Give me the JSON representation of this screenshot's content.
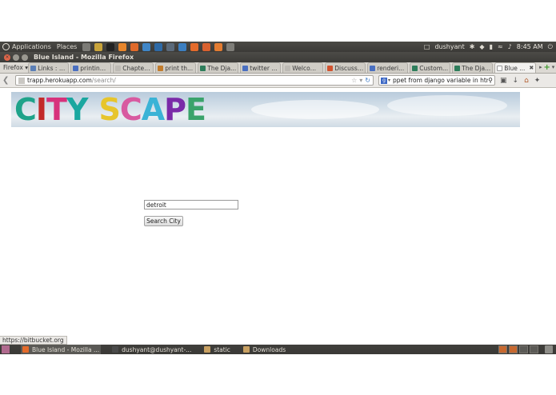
{
  "panel": {
    "menus": [
      "Applications",
      "Places"
    ],
    "launchers": [
      {
        "icon": "terminal-launcher-icon",
        "color": "#7c7b76"
      },
      {
        "icon": "notes-launcher-icon",
        "color": "#c9a43a"
      },
      {
        "icon": "camera-launcher-icon",
        "color": "#222222"
      },
      {
        "icon": "vlc-launcher-icon",
        "color": "#e8862b"
      },
      {
        "icon": "sublime-launcher-icon",
        "color": "#e06a2a"
      },
      {
        "icon": "qt-launcher-icon",
        "color": "#3f86c7"
      },
      {
        "icon": "eclipse-launcher-icon",
        "color": "#2e6aa6"
      },
      {
        "icon": "monitor-launcher-icon",
        "color": "#5b6a7a"
      },
      {
        "icon": "browser-launcher-icon",
        "color": "#3c7fc1"
      },
      {
        "icon": "firefox-launcher-icon",
        "color": "#e46b2b"
      },
      {
        "icon": "folder-launcher-icon",
        "color": "#d9612f"
      },
      {
        "icon": "archive-launcher-icon",
        "color": "#e37c31"
      },
      {
        "icon": "screen-launcher-icon",
        "color": "#7f7e79"
      }
    ],
    "user": "dushyant",
    "time": "8:45 AM"
  },
  "window": {
    "title": "Blue Island - Mozilla Firefox"
  },
  "tabstrip": {
    "firefox_menu": "Firefox",
    "tabs": [
      {
        "label": "Links : C...",
        "color": "#5b7fb6"
      },
      {
        "label": "printing...",
        "color": "#4a6fc0"
      },
      {
        "label": "Chapter...",
        "color": "#bdbab4"
      },
      {
        "label": "print th...",
        "color": "#c27c2c"
      },
      {
        "label": "The Dja...",
        "color": "#2e7d5b"
      },
      {
        "label": "twitter ...",
        "color": "#4a6fc0"
      },
      {
        "label": "Welcom...",
        "color": "#bdbab4"
      },
      {
        "label": "Discussi...",
        "color": "#d2532f"
      },
      {
        "label": "renderi...",
        "color": "#4a6fc0"
      },
      {
        "label": "Custom...",
        "color": "#2e7d5b"
      },
      {
        "label": "The Dja...",
        "color": "#2e7d5b"
      },
      {
        "label": "Blue ...",
        "color": "#ffffff",
        "active": true
      }
    ]
  },
  "navbar": {
    "url_host": "trapp.herokuapp.com",
    "url_path": "/search/",
    "search_query": "ppet from  django variable in html"
  },
  "page": {
    "logo": [
      {
        "ch": "C",
        "color": "#1fa38a"
      },
      {
        "ch": "I",
        "color": "#c22a2a"
      },
      {
        "ch": "T",
        "color": "#d7327c"
      },
      {
        "ch": "Y",
        "color": "#1aa7a0"
      },
      {
        "ch": " ",
        "color": "#ffffff"
      },
      {
        "ch": "S",
        "color": "#e7c52c"
      },
      {
        "ch": "C",
        "color": "#d85aa0"
      },
      {
        "ch": "A",
        "color": "#3bb3d6"
      },
      {
        "ch": "P",
        "color": "#7a2aa8"
      },
      {
        "ch": "E",
        "color": "#3aa36b"
      }
    ],
    "search_value": "detroit",
    "search_button": "Search City"
  },
  "status_bar": {
    "text": "https://bitbucket.org"
  },
  "taskbar": {
    "tasks": [
      {
        "label": "Blue Island - Mozilla ...",
        "color": "#e46b2b",
        "active": true
      },
      {
        "label": "dushyant@dushyant-...",
        "color": "#4a4a4a"
      },
      {
        "label": "static",
        "color": "#c8a062"
      },
      {
        "label": "Downloads",
        "color": "#c8a062"
      }
    ]
  }
}
